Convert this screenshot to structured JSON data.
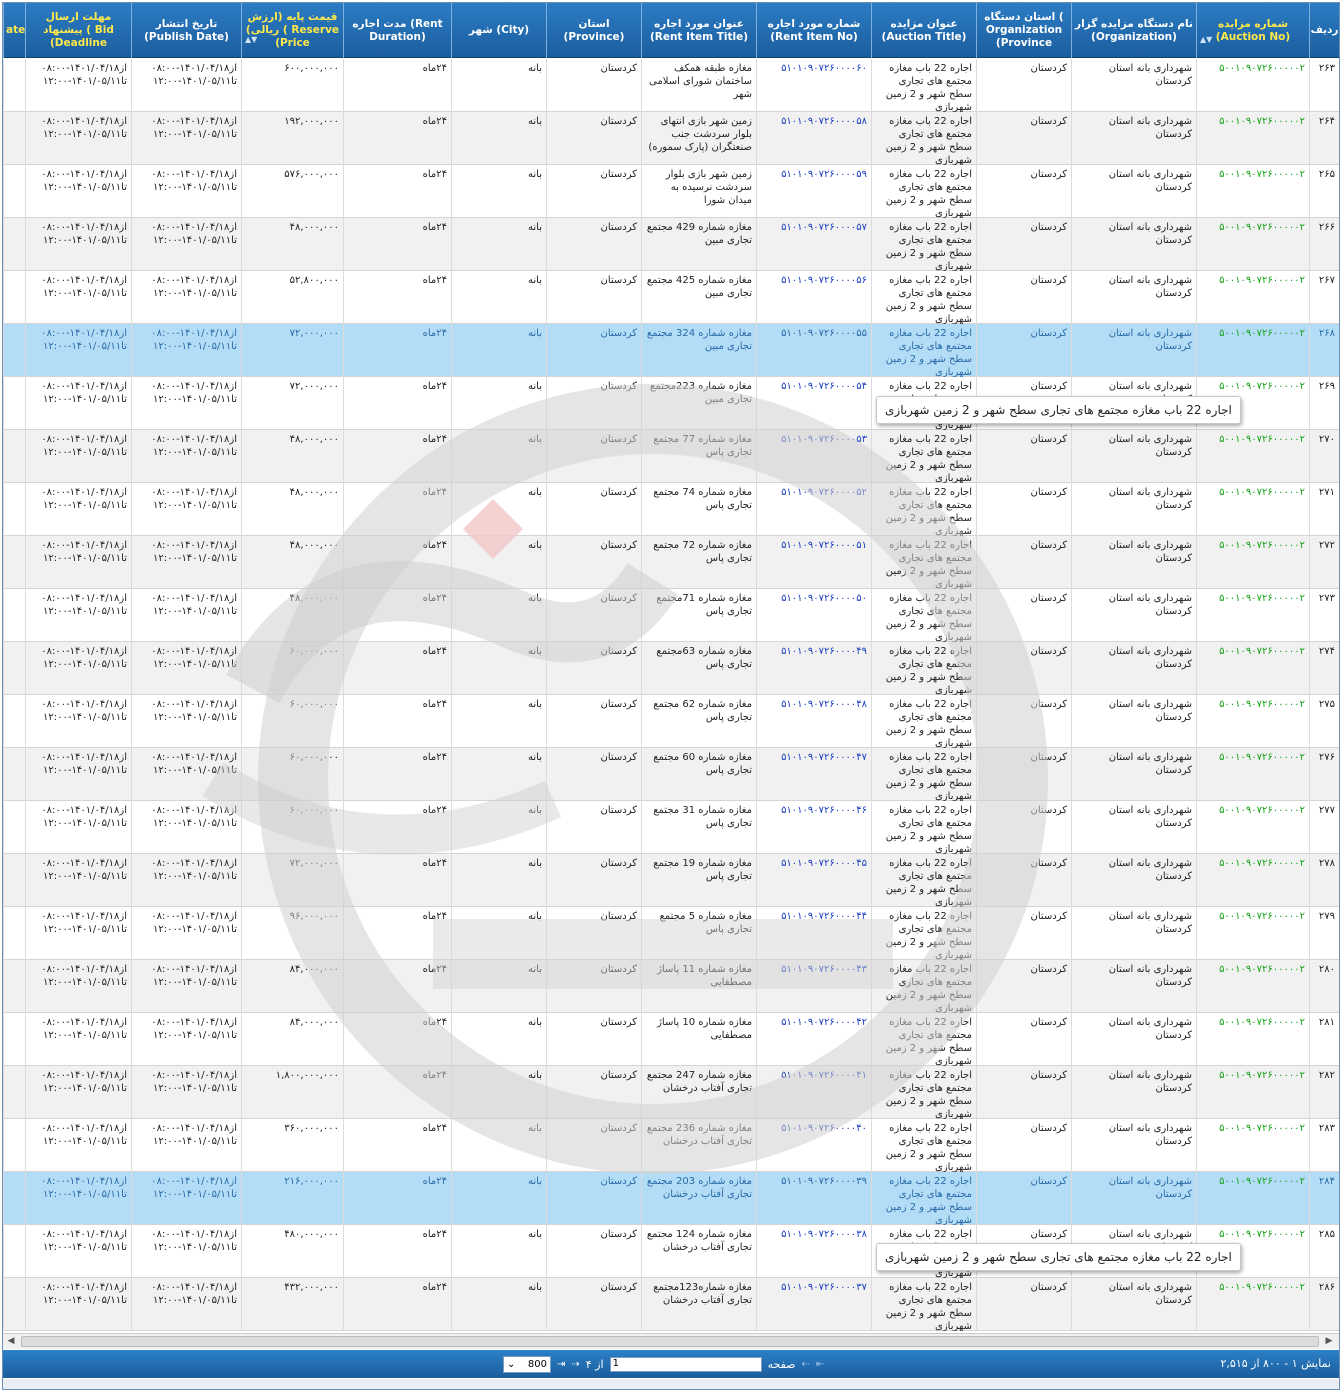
{
  "columns": {
    "row_no": "ردیف",
    "auction_no": "شماره مزایده (Auction No)",
    "organization": "نام دستگاه مزایده گزار (Organization)",
    "org_province": "استان دستگاه ( Organization (Province",
    "auction_title": "عنوان مزایده (Auction Title)",
    "rent_item_no": "شماره مورد اجاره (Rent Item No)",
    "rent_item_title": "عنوان مورد اجاره (Rent Item Title)",
    "province": "استان (Province)",
    "city": "شهر (City)",
    "rent_duration": "مدت اجاره (Rent Duration)",
    "price": "قیمت پایه (ارزش ریالی) ( Reserve (Price",
    "publish_date": "تاریخ انتشار (Publish Date)",
    "deadline": "مهلت ارسال پیشنهاد ( Bid (Deadline",
    "cut_edge": "ate"
  },
  "rows": [
    {
      "no": "۲۶۳",
      "auction_no": "۵۰۰۱۰۹۰۷۲۶۰۰۰۰۰۲",
      "org": "شهرداری بانه استان کردستان",
      "org_province": "کردستان",
      "title": "اجاره 22 باب مغازه مجتمع های تجاری سطح شهر و 2 زمین شهربازی",
      "item_no": "۵۱۰۱۰۹۰۷۲۶۰۰۰۰۶۰",
      "item_title": "مغازه طبقه همکف ساختمان شورای اسلامی شهر",
      "province": "کردستان",
      "city": "بانه",
      "duration": "۲۴ماه",
      "price": "۶۰۰,۰۰۰,۰۰۰",
      "publish": "از۱۴۰۱/۰۴/۱۸-۰۸:۰۰ تا۱۴۰۱/۰۵/۱۱-۱۲:۰۰",
      "deadline": "از۱۴۰۱/۰۴/۱۸-۰۸:۰۰ تا۱۴۰۱/۰۵/۱۱-۱۲:۰۰"
    },
    {
      "no": "۲۶۴",
      "auction_no": "۵۰۰۱۰۹۰۷۲۶۰۰۰۰۰۲",
      "org": "شهرداری بانه استان کردستان",
      "org_province": "کردستان",
      "title": "اجاره 22 باب مغازه مجتمع های تجاری سطح شهر و 2 زمین شهربازی",
      "item_no": "۵۱۰۱۰۹۰۷۲۶۰۰۰۰۵۸",
      "item_title": "زمین شهر بازی انتهای بلوار سردشت جنب صنعتگران (پارک سموره)",
      "province": "کردستان",
      "city": "بانه",
      "duration": "۲۴ماه",
      "price": "۱۹۲,۰۰۰,۰۰۰",
      "publish": "از۱۴۰۱/۰۴/۱۸-۰۸:۰۰ تا۱۴۰۱/۰۵/۱۱-۱۲:۰۰",
      "deadline": "از۱۴۰۱/۰۴/۱۸-۰۸:۰۰ تا۱۴۰۱/۰۵/۱۱-۱۲:۰۰"
    },
    {
      "no": "۲۶۵",
      "auction_no": "۵۰۰۱۰۹۰۷۲۶۰۰۰۰۰۲",
      "org": "شهرداری بانه استان کردستان",
      "org_province": "کردستان",
      "title": "اجاره 22 باب مغازه مجتمع های تجاری سطح شهر و 2 زمین شهربازی",
      "item_no": "۵۱۰۱۰۹۰۷۲۶۰۰۰۰۵۹",
      "item_title": "زمین شهر بازی بلوار سردشت نرسیده به میدان شورا",
      "province": "کردستان",
      "city": "بانه",
      "duration": "۲۴ماه",
      "price": "۵۷۶,۰۰۰,۰۰۰",
      "publish": "از۱۴۰۱/۰۴/۱۸-۰۸:۰۰ تا۱۴۰۱/۰۵/۱۱-۱۲:۰۰",
      "deadline": "از۱۴۰۱/۰۴/۱۸-۰۸:۰۰ تا۱۴۰۱/۰۵/۱۱-۱۲:۰۰"
    },
    {
      "no": "۲۶۶",
      "auction_no": "۵۰۰۱۰۹۰۷۲۶۰۰۰۰۰۲",
      "org": "شهرداری بانه استان کردستان",
      "org_province": "کردستان",
      "title": "اجاره 22 باب مغازه مجتمع های تجاری سطح شهر و 2 زمین شهربازی",
      "item_no": "۵۱۰۱۰۹۰۷۲۶۰۰۰۰۵۷",
      "item_title": "مغازه شماره 429 مجتمع تجاری مبین",
      "province": "کردستان",
      "city": "بانه",
      "duration": "۲۴ماه",
      "price": "۴۸,۰۰۰,۰۰۰",
      "publish": "از۱۴۰۱/۰۴/۱۸-۰۸:۰۰ تا۱۴۰۱/۰۵/۱۱-۱۲:۰۰",
      "deadline": "از۱۴۰۱/۰۴/۱۸-۰۸:۰۰ تا۱۴۰۱/۰۵/۱۱-۱۲:۰۰"
    },
    {
      "no": "۲۶۷",
      "auction_no": "۵۰۰۱۰۹۰۷۲۶۰۰۰۰۰۲",
      "org": "شهرداری بانه استان کردستان",
      "org_province": "کردستان",
      "title": "اجاره 22 باب مغازه مجتمع های تجاری سطح شهر و 2 زمین شهربازی",
      "item_no": "۵۱۰۱۰۹۰۷۲۶۰۰۰۰۵۶",
      "item_title": "مغازه شماره 425 مجتمع تجاری مبین",
      "province": "کردستان",
      "city": "بانه",
      "duration": "۲۴ماه",
      "price": "۵۲,۸۰۰,۰۰۰",
      "publish": "از۱۴۰۱/۰۴/۱۸-۰۸:۰۰ تا۱۴۰۱/۰۵/۱۱-۱۲:۰۰",
      "deadline": "از۱۴۰۱/۰۴/۱۸-۰۸:۰۰ تا۱۴۰۱/۰۵/۱۱-۱۲:۰۰"
    },
    {
      "no": "۲۶۸",
      "auction_no": "۵۰۰۱۰۹۰۷۲۶۰۰۰۰۰۲",
      "org": "شهرداری بانه استان کردستان",
      "org_province": "کردستان",
      "title": "اجاره 22 باب مغازه مجتمع های تجاری سطح شهر و 2 زمین شهربازی",
      "item_no": "۵۱۰۱۰۹۰۷۲۶۰۰۰۰۵۵",
      "item_title": "مغازه شماره 324 مجتمع تجاری مبین",
      "province": "کردستان",
      "city": "بانه",
      "duration": "۲۴ماه",
      "price": "۷۲,۰۰۰,۰۰۰",
      "publish": "از۱۴۰۱/۰۴/۱۸-۰۸:۰۰ تا۱۴۰۱/۰۵/۱۱-۱۲:۰۰",
      "deadline": "از۱۴۰۱/۰۴/۱۸-۰۸:۰۰ تا۱۴۰۱/۰۵/۱۱-۱۲:۰۰",
      "selected": true
    },
    {
      "no": "۲۶۹",
      "auction_no": "۵۰۰۱۰۹۰۷۲۶۰۰۰۰۰۲",
      "org": "شهرداری بانه استان کردستان",
      "org_province": "کردستان",
      "title": "اجاره 22 باب مغازه مجتمع های تجاری سطح شهر و 2 زمین شهربازی",
      "item_no": "۵۱۰۱۰۹۰۷۲۶۰۰۰۰۵۴",
      "item_title": "مغازه شماره 223مجتمع تجاری مبین",
      "province": "کردستان",
      "city": "بانه",
      "duration": "۲۴ماه",
      "price": "۷۲,۰۰۰,۰۰۰",
      "publish": "از۱۴۰۱/۰۴/۱۸-۰۸:۰۰ تا۱۴۰۱/۰۵/۱۱-۱۲:۰۰",
      "deadline": "از۱۴۰۱/۰۴/۱۸-۰۸:۰۰ تا۱۴۰۱/۰۵/۱۱-۱۲:۰۰"
    },
    {
      "no": "۲۷۰",
      "auction_no": "۵۰۰۱۰۹۰۷۲۶۰۰۰۰۰۲",
      "org": "شهرداری بانه استان کردستان",
      "org_province": "کردستان",
      "title": "اجاره 22 باب مغازه مجتمع های تجاری سطح شهر و 2 زمین شهربازی",
      "item_no": "۵۱۰۱۰۹۰۷۲۶۰۰۰۰۵۳",
      "item_title": "مغازه شماره 77 مجتمع تجاری پاس",
      "province": "کردستان",
      "city": "بانه",
      "duration": "۲۴ماه",
      "price": "۴۸,۰۰۰,۰۰۰",
      "publish": "از۱۴۰۱/۰۴/۱۸-۰۸:۰۰ تا۱۴۰۱/۰۵/۱۱-۱۲:۰۰",
      "deadline": "از۱۴۰۱/۰۴/۱۸-۰۸:۰۰ تا۱۴۰۱/۰۵/۱۱-۱۲:۰۰"
    },
    {
      "no": "۲۷۱",
      "auction_no": "۵۰۰۱۰۹۰۷۲۶۰۰۰۰۰۲",
      "org": "شهرداری بانه استان کردستان",
      "org_province": "کردستان",
      "title": "اجاره 22 باب مغازه مجتمع های تجاری سطح شهر و 2 زمین شهربازی",
      "item_no": "۵۱۰۱۰۹۰۷۲۶۰۰۰۰۵۲",
      "item_title": "مغازه شماره 74 مجتمع تجاری پاس",
      "province": "کردستان",
      "city": "بانه",
      "duration": "۲۴ماه",
      "price": "۴۸,۰۰۰,۰۰۰",
      "publish": "از۱۴۰۱/۰۴/۱۸-۰۸:۰۰ تا۱۴۰۱/۰۵/۱۱-۱۲:۰۰",
      "deadline": "از۱۴۰۱/۰۴/۱۸-۰۸:۰۰ تا۱۴۰۱/۰۵/۱۱-۱۲:۰۰"
    },
    {
      "no": "۲۷۲",
      "auction_no": "۵۰۰۱۰۹۰۷۲۶۰۰۰۰۰۲",
      "org": "شهرداری بانه استان کردستان",
      "org_province": "کردستان",
      "title": "اجاره 22 باب مغازه مجتمع های تجاری سطح شهر و 2 زمین شهربازی",
      "item_no": "۵۱۰۱۰۹۰۷۲۶۰۰۰۰۵۱",
      "item_title": "مغازه شماره 72 مجتمع تجاری پاس",
      "province": "کردستان",
      "city": "بانه",
      "duration": "۲۴ماه",
      "price": "۴۸,۰۰۰,۰۰۰",
      "publish": "از۱۴۰۱/۰۴/۱۸-۰۸:۰۰ تا۱۴۰۱/۰۵/۱۱-۱۲:۰۰",
      "deadline": "از۱۴۰۱/۰۴/۱۸-۰۸:۰۰ تا۱۴۰۱/۰۵/۱۱-۱۲:۰۰"
    },
    {
      "no": "۲۷۳",
      "auction_no": "۵۰۰۱۰۹۰۷۲۶۰۰۰۰۰۲",
      "org": "شهرداری بانه استان کردستان",
      "org_province": "کردستان",
      "title": "اجاره 22 باب مغازه مجتمع های تجاری سطح شهر و 2 زمین شهربازی",
      "item_no": "۵۱۰۱۰۹۰۷۲۶۰۰۰۰۵۰",
      "item_title": "مغازه شماره 71مجتمع تجاری پاس",
      "province": "کردستان",
      "city": "بانه",
      "duration": "۲۴ماه",
      "price": "۴۸,۰۰۰,۰۰۰",
      "publish": "از۱۴۰۱/۰۴/۱۸-۰۸:۰۰ تا۱۴۰۱/۰۵/۱۱-۱۲:۰۰",
      "deadline": "از۱۴۰۱/۰۴/۱۸-۰۸:۰۰ تا۱۴۰۱/۰۵/۱۱-۱۲:۰۰"
    },
    {
      "no": "۲۷۴",
      "auction_no": "۵۰۰۱۰۹۰۷۲۶۰۰۰۰۰۲",
      "org": "شهرداری بانه استان کردستان",
      "org_province": "کردستان",
      "title": "اجاره 22 باب مغازه مجتمع های تجاری سطح شهر و 2 زمین شهربازی",
      "item_no": "۵۱۰۱۰۹۰۷۲۶۰۰۰۰۴۹",
      "item_title": "مغازه شماره 63مجتمع تجاری پاس",
      "province": "کردستان",
      "city": "بانه",
      "duration": "۲۴ماه",
      "price": "۶۰,۰۰۰,۰۰۰",
      "publish": "از۱۴۰۱/۰۴/۱۸-۰۸:۰۰ تا۱۴۰۱/۰۵/۱۱-۱۲:۰۰",
      "deadline": "از۱۴۰۱/۰۴/۱۸-۰۸:۰۰ تا۱۴۰۱/۰۵/۱۱-۱۲:۰۰"
    },
    {
      "no": "۲۷۵",
      "auction_no": "۵۰۰۱۰۹۰۷۲۶۰۰۰۰۰۲",
      "org": "شهرداری بانه استان کردستان",
      "org_province": "کردستان",
      "title": "اجاره 22 باب مغازه مجتمع های تجاری سطح شهر و 2 زمین شهربازی",
      "item_no": "۵۱۰۱۰۹۰۷۲۶۰۰۰۰۴۸",
      "item_title": "مغازه شماره 62 مجتمع تجاری پاس",
      "province": "کردستان",
      "city": "بانه",
      "duration": "۲۴ماه",
      "price": "۶۰,۰۰۰,۰۰۰",
      "publish": "از۱۴۰۱/۰۴/۱۸-۰۸:۰۰ تا۱۴۰۱/۰۵/۱۱-۱۲:۰۰",
      "deadline": "از۱۴۰۱/۰۴/۱۸-۰۸:۰۰ تا۱۴۰۱/۰۵/۱۱-۱۲:۰۰"
    },
    {
      "no": "۲۷۶",
      "auction_no": "۵۰۰۱۰۹۰۷۲۶۰۰۰۰۰۲",
      "org": "شهرداری بانه استان کردستان",
      "org_province": "کردستان",
      "title": "اجاره 22 باب مغازه مجتمع های تجاری سطح شهر و 2 زمین شهربازی",
      "item_no": "۵۱۰۱۰۹۰۷۲۶۰۰۰۰۴۷",
      "item_title": "مغازه شماره 60 مجتمع تجاری پاس",
      "province": "کردستان",
      "city": "بانه",
      "duration": "۲۴ماه",
      "price": "۶۰,۰۰۰,۰۰۰",
      "publish": "از۱۴۰۱/۰۴/۱۸-۰۸:۰۰ تا۱۴۰۱/۰۵/۱۱-۱۲:۰۰",
      "deadline": "از۱۴۰۱/۰۴/۱۸-۰۸:۰۰ تا۱۴۰۱/۰۵/۱۱-۱۲:۰۰"
    },
    {
      "no": "۲۷۷",
      "auction_no": "۵۰۰۱۰۹۰۷۲۶۰۰۰۰۰۲",
      "org": "شهرداری بانه استان کردستان",
      "org_province": "کردستان",
      "title": "اجاره 22 باب مغازه مجتمع های تجاری سطح شهر و 2 زمین شهربازی",
      "item_no": "۵۱۰۱۰۹۰۷۲۶۰۰۰۰۴۶",
      "item_title": "مغازه شماره 31 مجتمع تجاری پاس",
      "province": "کردستان",
      "city": "بانه",
      "duration": "۲۴ماه",
      "price": "۶۰,۰۰۰,۰۰۰",
      "publish": "از۱۴۰۱/۰۴/۱۸-۰۸:۰۰ تا۱۴۰۱/۰۵/۱۱-۱۲:۰۰",
      "deadline": "از۱۴۰۱/۰۴/۱۸-۰۸:۰۰ تا۱۴۰۱/۰۵/۱۱-۱۲:۰۰"
    },
    {
      "no": "۲۷۸",
      "auction_no": "۵۰۰۱۰۹۰۷۲۶۰۰۰۰۰۲",
      "org": "شهرداری بانه استان کردستان",
      "org_province": "کردستان",
      "title": "اجاره 22 باب مغازه مجتمع های تجاری سطح شهر و 2 زمین شهربازی",
      "item_no": "۵۱۰۱۰۹۰۷۲۶۰۰۰۰۴۵",
      "item_title": "مغازه شماره 19 مجتمع تجاری پاس",
      "province": "کردستان",
      "city": "بانه",
      "duration": "۲۴ماه",
      "price": "۷۲,۰۰۰,۰۰۰",
      "publish": "از۱۴۰۱/۰۴/۱۸-۰۸:۰۰ تا۱۴۰۱/۰۵/۱۱-۱۲:۰۰",
      "deadline": "از۱۴۰۱/۰۴/۱۸-۰۸:۰۰ تا۱۴۰۱/۰۵/۱۱-۱۲:۰۰"
    },
    {
      "no": "۲۷۹",
      "auction_no": "۵۰۰۱۰۹۰۷۲۶۰۰۰۰۰۲",
      "org": "شهرداری بانه استان کردستان",
      "org_province": "کردستان",
      "title": "اجاره 22 باب مغازه مجتمع های تجاری سطح شهر و 2 زمین شهربازی",
      "item_no": "۵۱۰۱۰۹۰۷۲۶۰۰۰۰۴۴",
      "item_title": "مغازه شماره 5 مجتمع تجاری پاس",
      "province": "کردستان",
      "city": "بانه",
      "duration": "۲۴ماه",
      "price": "۹۶,۰۰۰,۰۰۰",
      "publish": "از۱۴۰۱/۰۴/۱۸-۰۸:۰۰ تا۱۴۰۱/۰۵/۱۱-۱۲:۰۰",
      "deadline": "از۱۴۰۱/۰۴/۱۸-۰۸:۰۰ تا۱۴۰۱/۰۵/۱۱-۱۲:۰۰"
    },
    {
      "no": "۲۸۰",
      "auction_no": "۵۰۰۱۰۹۰۷۲۶۰۰۰۰۰۲",
      "org": "شهرداری بانه استان کردستان",
      "org_province": "کردستان",
      "title": "اجاره 22 باب مغازه مجتمع های تجاری سطح شهر و 2 زمین شهربازی",
      "item_no": "۵۱۰۱۰۹۰۷۲۶۰۰۰۰۴۳",
      "item_title": "مغازه شماره 11 پاساژ مصطفایی",
      "province": "کردستان",
      "city": "بانه",
      "duration": "۲۴ماه",
      "price": "۸۴,۰۰۰,۰۰۰",
      "publish": "از۱۴۰۱/۰۴/۱۸-۰۸:۰۰ تا۱۴۰۱/۰۵/۱۱-۱۲:۰۰",
      "deadline": "از۱۴۰۱/۰۴/۱۸-۰۸:۰۰ تا۱۴۰۱/۰۵/۱۱-۱۲:۰۰"
    },
    {
      "no": "۲۸۱",
      "auction_no": "۵۰۰۱۰۹۰۷۲۶۰۰۰۰۰۲",
      "org": "شهرداری بانه استان کردستان",
      "org_province": "کردستان",
      "title": "اجاره 22 باب مغازه مجتمع های تجاری سطح شهر و 2 زمین شهربازی",
      "item_no": "۵۱۰۱۰۹۰۷۲۶۰۰۰۰۴۲",
      "item_title": "مغازه شماره 10 پاساژ مصطفایی",
      "province": "کردستان",
      "city": "بانه",
      "duration": "۲۴ماه",
      "price": "۸۴,۰۰۰,۰۰۰",
      "publish": "از۱۴۰۱/۰۴/۱۸-۰۸:۰۰ تا۱۴۰۱/۰۵/۱۱-۱۲:۰۰",
      "deadline": "از۱۴۰۱/۰۴/۱۸-۰۸:۰۰ تا۱۴۰۱/۰۵/۱۱-۱۲:۰۰"
    },
    {
      "no": "۲۸۲",
      "auction_no": "۵۰۰۱۰۹۰۷۲۶۰۰۰۰۰۲",
      "org": "شهرداری بانه استان کردستان",
      "org_province": "کردستان",
      "title": "اجاره 22 باب مغازه مجتمع های تجاری سطح شهر و 2 زمین شهربازی",
      "item_no": "۵۱۰۱۰۹۰۷۲۶۰۰۰۰۴۱",
      "item_title": "مغازه شماره 247 مجتمع تجاری آفتاب درخشان",
      "province": "کردستان",
      "city": "بانه",
      "duration": "۲۴ماه",
      "price": "۱,۸۰۰,۰۰۰,۰۰۰",
      "publish": "از۱۴۰۱/۰۴/۱۸-۰۸:۰۰ تا۱۴۰۱/۰۵/۱۱-۱۲:۰۰",
      "deadline": "از۱۴۰۱/۰۴/۱۸-۰۸:۰۰ تا۱۴۰۱/۰۵/۱۱-۱۲:۰۰"
    },
    {
      "no": "۲۸۳",
      "auction_no": "۵۰۰۱۰۹۰۷۲۶۰۰۰۰۰۲",
      "org": "شهرداری بانه استان کردستان",
      "org_province": "کردستان",
      "title": "اجاره 22 باب مغازه مجتمع های تجاری سطح شهر و 2 زمین شهربازی",
      "item_no": "۵۱۰۱۰۹۰۷۲۶۰۰۰۰۴۰",
      "item_title": "مغازه شماره 236 مجتمع تجاری آفتاب درخشان",
      "province": "کردستان",
      "city": "بانه",
      "duration": "۲۴ماه",
      "price": "۳۶۰,۰۰۰,۰۰۰",
      "publish": "از۱۴۰۱/۰۴/۱۸-۰۸:۰۰ تا۱۴۰۱/۰۵/۱۱-۱۲:۰۰",
      "deadline": "از۱۴۰۱/۰۴/۱۸-۰۸:۰۰ تا۱۴۰۱/۰۵/۱۱-۱۲:۰۰"
    },
    {
      "no": "۲۸۴",
      "auction_no": "۵۰۰۱۰۹۰۷۲۶۰۰۰۰۰۲",
      "org": "شهرداری بانه استان کردستان",
      "org_province": "کردستان",
      "title": "اجاره 22 باب مغازه مجتمع های تجاری سطح شهر و 2 زمین شهربازی",
      "item_no": "۵۱۰۱۰۹۰۷۲۶۰۰۰۰۳۹",
      "item_title": "مغازه شماره 203 مجتمع تجاری آفتاب درخشان",
      "province": "کردستان",
      "city": "بانه",
      "duration": "۲۴ماه",
      "price": "۲۱۶,۰۰۰,۰۰۰",
      "publish": "از۱۴۰۱/۰۴/۱۸-۰۸:۰۰ تا۱۴۰۱/۰۵/۱۱-۱۲:۰۰",
      "deadline": "از۱۴۰۱/۰۴/۱۸-۰۸:۰۰ تا۱۴۰۱/۰۵/۱۱-۱۲:۰۰",
      "selected": true
    },
    {
      "no": "۲۸۵",
      "auction_no": "۵۰۰۱۰۹۰۷۲۶۰۰۰۰۰۲",
      "org": "شهرداری بانه استان کردستان",
      "org_province": "کردستان",
      "title": "اجاره 22 باب مغازه مجتمع های تجاری سطح شهر و 2 زمین شهربازی",
      "item_no": "۵۱۰۱۰۹۰۷۲۶۰۰۰۰۳۸",
      "item_title": "مغازه شماره 124 مجتمع تجاری آفتاب درخشان",
      "province": "کردستان",
      "city": "بانه",
      "duration": "۲۴ماه",
      "price": "۴۸۰,۰۰۰,۰۰۰",
      "publish": "از۱۴۰۱/۰۴/۱۸-۰۸:۰۰ تا۱۴۰۱/۰۵/۱۱-۱۲:۰۰",
      "deadline": "از۱۴۰۱/۰۴/۱۸-۰۸:۰۰ تا۱۴۰۱/۰۵/۱۱-۱۲:۰۰"
    },
    {
      "no": "۲۸۶",
      "auction_no": "۵۰۰۱۰۹۰۷۲۶۰۰۰۰۰۲",
      "org": "شهرداری بانه استان کردستان",
      "org_province": "کردستان",
      "title": "اجاره 22 باب مغازه مجتمع های تجاری سطح شهر و 2 زمین شهربازی",
      "item_no": "۵۱۰۱۰۹۰۷۲۶۰۰۰۰۳۷",
      "item_title": "مغازه شماره123مجتمع تجاری آفتاب درخشان",
      "province": "کردستان",
      "city": "بانه",
      "duration": "۲۴ماه",
      "price": "۴۳۲,۰۰۰,۰۰۰",
      "publish": "از۱۴۰۱/۰۴/۱۸-۰۸:۰۰ تا۱۴۰۱/۰۵/۱۱-۱۲:۰۰",
      "deadline": "از۱۴۰۱/۰۴/۱۸-۰۸:۰۰ تا۱۴۰۱/۰۵/۱۱-۱۲:۰۰"
    }
  ],
  "tooltips": [
    {
      "text": "اجاره 22 باب مغازه مجتمع های تجاری سطح شهر و 2 زمین شهربازی"
    },
    {
      "text": "اجاره 22 باب مغازه مجتمع های تجاری سطح شهر و 2 زمین شهربازی"
    }
  ],
  "pager": {
    "info": "نمایش ۱ - ۸۰۰ از ۲,۵۱۵",
    "page_label": "صفحه",
    "page_value": "1",
    "of_label": "از ۴",
    "page_size": "800"
  },
  "colors": {
    "header_bg": "#1b5e9e",
    "selected_row": "#b3ddf6",
    "auction_no_green": "#18a318",
    "rent_item_blue": "#1c3fbf"
  }
}
